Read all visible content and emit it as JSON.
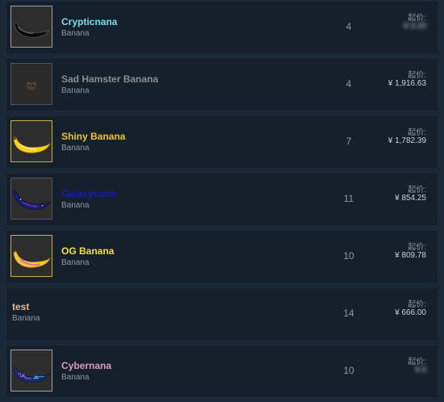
{
  "listings": [
    {
      "name": "Crypticnana",
      "type": "Banana",
      "quantity": "4",
      "price_label": "起价:",
      "price": "¥ 3.20",
      "name_color": "#7fdbe8",
      "icon": "crypticnana-banana-icon"
    },
    {
      "name": "Sad Hamster Banana",
      "type": "Banana",
      "quantity": "4",
      "price_label": "起价:",
      "price": "¥ 1,916.63",
      "name_color": "#8c8c8c",
      "icon": "sad-hamster-banana-icon"
    },
    {
      "name": "Shiny Banana",
      "type": "Banana",
      "quantity": "7",
      "price_label": "起价:",
      "price": "¥ 1,782.39",
      "name_color": "#e8c630",
      "icon": "shiny-banana-icon"
    },
    {
      "name": "Galaxynana",
      "type": "Banana",
      "quantity": "11",
      "price_label": "起价:",
      "price": "¥ 854.25",
      "name_color": "#1a1aa8",
      "icon": "galaxynana-banana-icon"
    },
    {
      "name": "OG Banana",
      "type": "Banana",
      "quantity": "10",
      "price_label": "起价:",
      "price": "¥ 809.78",
      "name_color": "#f2e23b",
      "icon": "og-banana-icon"
    },
    {
      "name": "test",
      "type": "Banana",
      "quantity": "14",
      "price_label": "起价:",
      "price": "¥ 666.00",
      "name_color": "#e8b98a",
      "icon": ""
    },
    {
      "name": "Cybernana",
      "type": "Banana",
      "quantity": "10",
      "price_label": "起价:",
      "price": "¥ 5",
      "name_color": "#d79ac0",
      "icon": "cybernana-banana-icon"
    }
  ]
}
